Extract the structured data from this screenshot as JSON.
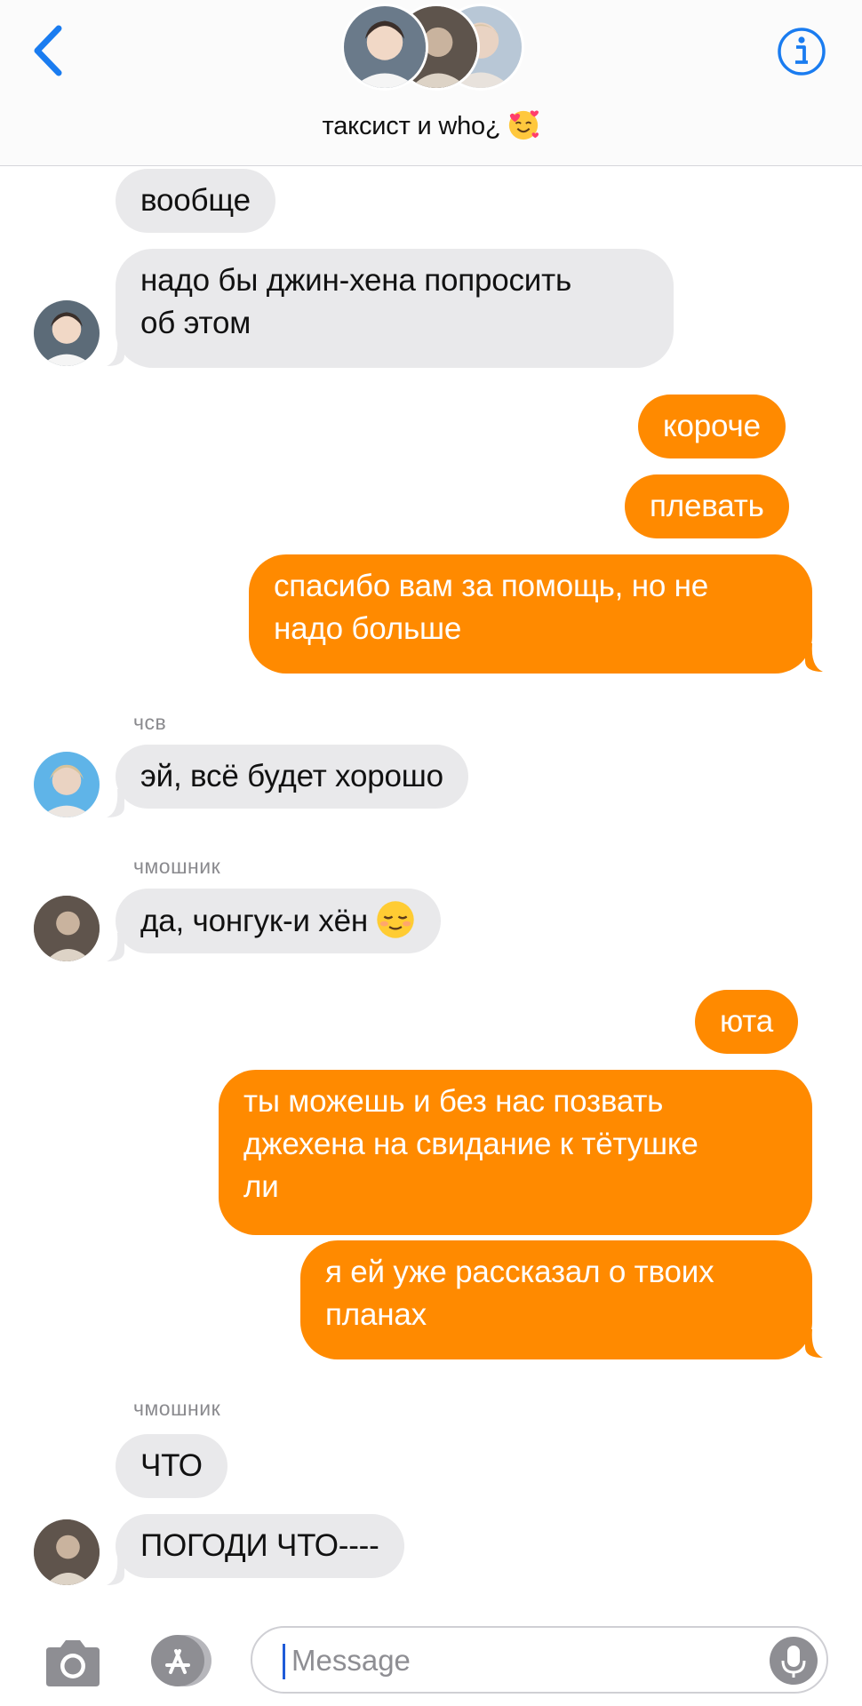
{
  "header": {
    "group_name": "таксист и who¿",
    "title_emoji": "smiling-face-with-hearts",
    "back_icon": "chevron-left-icon",
    "info_icon": "info-icon"
  },
  "colors": {
    "accent_blue": "#1a7cf0",
    "outgoing_bubble": "#ff8a00",
    "incoming_bubble": "#e9e9eb",
    "sender_name": "#8a8a8e"
  },
  "messages": [
    {
      "dir": "in",
      "text": "вообще"
    },
    {
      "dir": "in",
      "text": "надо бы джин-хена попросить\nоб этом"
    },
    {
      "dir": "out",
      "text": "короче"
    },
    {
      "dir": "out",
      "text": "плевать"
    },
    {
      "dir": "out",
      "text": "спасибо вам за помощь, но не\nнадо больше"
    },
    {
      "dir": "in",
      "sender": "чсв",
      "text": "эй, всё будет хорошо"
    },
    {
      "dir": "in",
      "sender": "чмошник",
      "text": "да, чонгук-и хён",
      "emoji": "relieved-face"
    },
    {
      "dir": "out",
      "text": "юта"
    },
    {
      "dir": "out",
      "text": "ты можешь и без нас позвать\nджехена на свидание к тётушке\nли"
    },
    {
      "dir": "out",
      "text": "я ей уже рассказал о твоих\nпланах"
    },
    {
      "dir": "in",
      "sender": "чмошник",
      "text": "ЧТО"
    },
    {
      "dir": "in",
      "text": "ПОГОДИ ЧТО----"
    }
  ],
  "input_bar": {
    "placeholder": "Message",
    "camera_icon": "camera-icon",
    "apps_icon": "app-store-icon",
    "mic_icon": "microphone-icon"
  }
}
